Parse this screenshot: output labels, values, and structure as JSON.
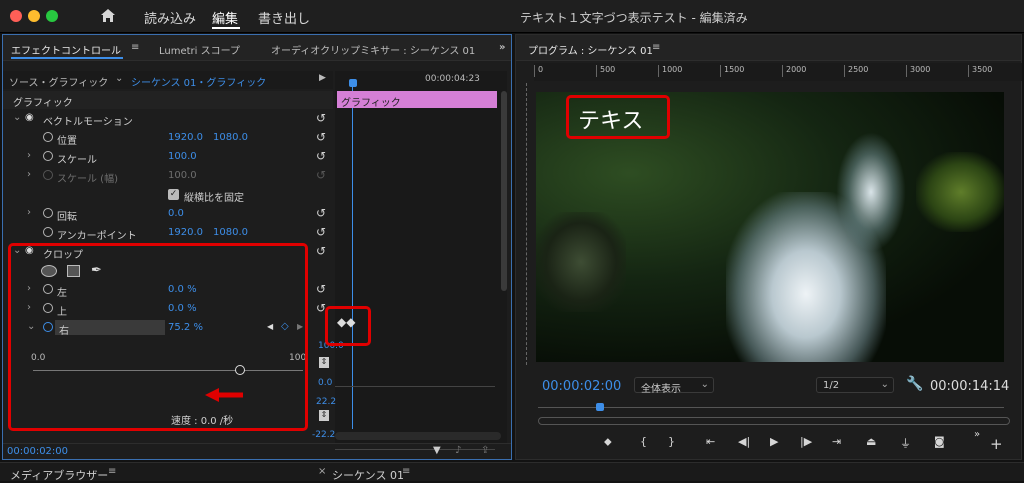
{
  "app": {
    "title": "テキスト１文字づつ表示テスト - 編集済み"
  },
  "menu": {
    "import": "読み込み",
    "edit": "編集",
    "export": "書き出し"
  },
  "effect_panel": {
    "tabs": {
      "effect_controls": "エフェクトコントロール",
      "lumetri": "Lumetri スコープ",
      "mixer": "オーディオクリップミキサー : シーケンス 01"
    },
    "source": "ソース・グラフィック",
    "sequence": "シーケンス 01・グラフィック",
    "timecode_right": "00:00:04:23",
    "graphic_header": "グラフィック",
    "clip_label": "グラフィック",
    "vector_motion": "ベクトルモーション",
    "rows": {
      "position": {
        "label": "位置",
        "v1": "1920.0",
        "v2": "1080.0"
      },
      "scale": {
        "label": "スケール",
        "v1": "100.0"
      },
      "scale_width": {
        "label": "スケール (幅)",
        "v1": "100.0"
      },
      "uniform": "縦横比を固定",
      "rotation": {
        "label": "回転",
        "v1": "0.0"
      },
      "anchor": {
        "label": "アンカーポイント",
        "v1": "1920.0",
        "v2": "1080.0"
      }
    },
    "crop": "クロップ",
    "crop_rows": {
      "left": {
        "label": "左",
        "v1": "0.0 %"
      },
      "top": {
        "label": "上",
        "v1": "0.0 %"
      },
      "right": {
        "label": "右",
        "v1": "75.2 %"
      }
    },
    "slider_min": "0.0",
    "slider_max": "100.",
    "graph_labels": {
      "top": "100.0",
      "mid1": "0.0",
      "mid2": "22.2",
      "bottom": "-22.2"
    },
    "speed": "速度 : 0.0 /秒",
    "bottom_timecode": "00:00:02:00"
  },
  "program": {
    "title": "プログラム : シーケンス 01",
    "ruler": [
      "0",
      "500",
      "1000",
      "1500",
      "2000",
      "2500",
      "3000",
      "3500"
    ],
    "overlay_text": "テキス",
    "timecode": "00:00:02:00",
    "fit": "全体表示",
    "resolution": "1/2",
    "duration": "00:00:14:14"
  },
  "bottom": {
    "media_browser": "メディアブラウザー",
    "sequence": "シーケンス 01"
  },
  "colors": {
    "accent": "#3d8ee8",
    "clip": "#d57fd6",
    "highlight": "#e00000"
  }
}
